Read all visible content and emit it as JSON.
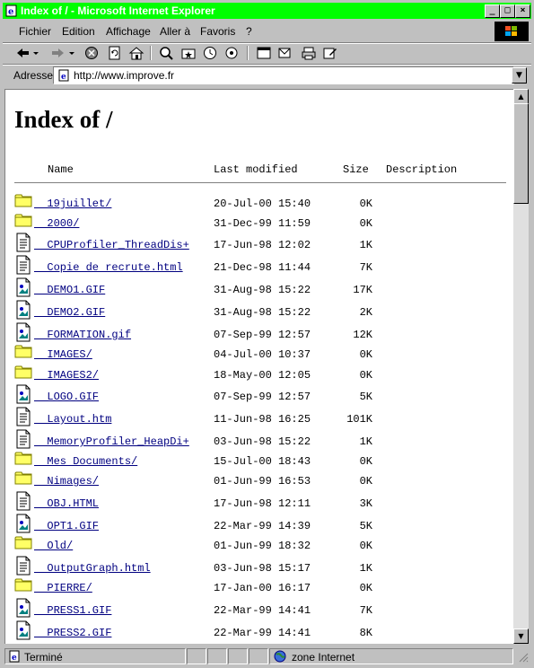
{
  "window": {
    "title": "Index of / - Microsoft Internet Explorer"
  },
  "menu": [
    "Fichier",
    "Edition",
    "Affichage",
    "Aller à",
    "Favoris",
    "?"
  ],
  "address": {
    "label": "Adresse",
    "url": "http://www.improve.fr"
  },
  "page": {
    "heading": "Index of /",
    "columns": {
      "name": "Name",
      "modified": "Last modified",
      "size": "Size",
      "description": "Description"
    },
    "entries": [
      {
        "type": "folder",
        "name": "19juillet/",
        "modified": "20-Jul-00 15:40",
        "size": "0K"
      },
      {
        "type": "folder",
        "name": "2000/",
        "modified": "31-Dec-99 11:59",
        "size": "0K"
      },
      {
        "type": "file",
        "name": "CPUProfiler_ThreadDis+",
        "modified": "17-Jun-98 12:02",
        "size": "1K"
      },
      {
        "type": "file",
        "name": "Copie de recrute.html",
        "modified": "21-Dec-98 11:44",
        "size": "7K"
      },
      {
        "type": "image",
        "name": "DEMO1.GIF",
        "modified": "31-Aug-98 15:22",
        "size": "17K"
      },
      {
        "type": "image",
        "name": "DEMO2.GIF",
        "modified": "31-Aug-98 15:22",
        "size": "2K"
      },
      {
        "type": "image",
        "name": "FORMATION.gif",
        "modified": "07-Sep-99 12:57",
        "size": "12K"
      },
      {
        "type": "folder",
        "name": "IMAGES/",
        "modified": "04-Jul-00 10:37",
        "size": "0K"
      },
      {
        "type": "folder",
        "name": "IMAGES2/",
        "modified": "18-May-00 12:05",
        "size": "0K"
      },
      {
        "type": "image",
        "name": "LOGO.GIF",
        "modified": "07-Sep-99 12:57",
        "size": "5K"
      },
      {
        "type": "file",
        "name": "Layout.htm",
        "modified": "11-Jun-98 16:25",
        "size": "101K"
      },
      {
        "type": "file",
        "name": "MemoryProfiler_HeapDi+",
        "modified": "03-Jun-98 15:22",
        "size": "1K"
      },
      {
        "type": "folder",
        "name": "Mes Documents/",
        "modified": "15-Jul-00 18:43",
        "size": "0K"
      },
      {
        "type": "folder",
        "name": "Nimages/",
        "modified": "01-Jun-99 16:53",
        "size": "0K"
      },
      {
        "type": "file",
        "name": "OBJ.HTML",
        "modified": "17-Jun-98 12:11",
        "size": "3K"
      },
      {
        "type": "image",
        "name": "OPT1.GIF",
        "modified": "22-Mar-99 14:39",
        "size": "5K"
      },
      {
        "type": "folder",
        "name": "Old/",
        "modified": "01-Jun-99 18:32",
        "size": "0K"
      },
      {
        "type": "file",
        "name": "OutputGraph.html",
        "modified": "03-Jun-98 15:17",
        "size": "1K"
      },
      {
        "type": "folder",
        "name": "PIERRE/",
        "modified": "17-Jan-00 16:17",
        "size": "0K"
      },
      {
        "type": "image",
        "name": "PRESS1.GIF",
        "modified": "22-Mar-99 14:41",
        "size": "7K"
      },
      {
        "type": "image",
        "name": "PRESS2.GIF",
        "modified": "22-Mar-99 14:41",
        "size": "8K"
      }
    ]
  },
  "status": {
    "left": "Terminé",
    "zone": "zone Internet"
  },
  "icons": {
    "folder": "folder-icon",
    "file": "text-file-icon",
    "image": "image-file-icon"
  },
  "colors": {
    "titlebar": "#00ff00",
    "link": "#000080",
    "chrome": "#c0c0c0"
  }
}
